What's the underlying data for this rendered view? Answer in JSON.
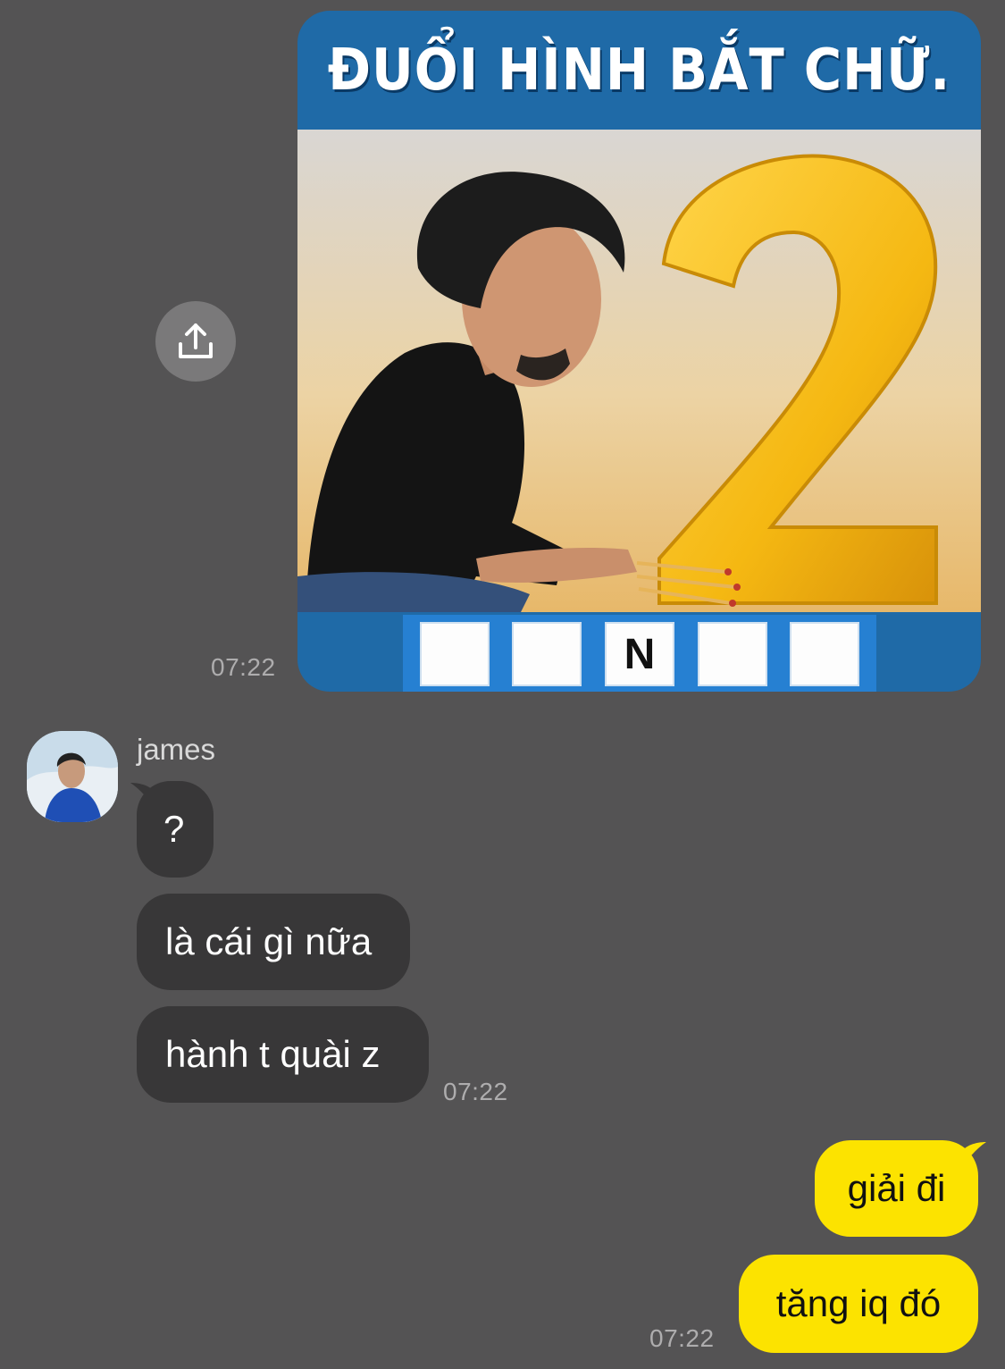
{
  "share": {
    "icon": "share-upload-icon"
  },
  "image_message": {
    "title": "ĐUỔI HÌNH BẮT CHỮ.",
    "answer_boxes": [
      "",
      "",
      "N",
      "",
      ""
    ],
    "time": "07:22"
  },
  "incoming": {
    "sender": "james",
    "avatar_icon": "user-avatar",
    "messages": [
      "?",
      "là cái gì nữa",
      "hành t quài z"
    ],
    "time": "07:22"
  },
  "outgoing": {
    "messages": [
      "giải đi",
      "tăng iq đó"
    ],
    "time": "07:22"
  },
  "colors": {
    "background": "#545354",
    "incoming_bubble": "#383738",
    "outgoing_bubble": "#fce300",
    "timestamp": "#aeadae"
  }
}
